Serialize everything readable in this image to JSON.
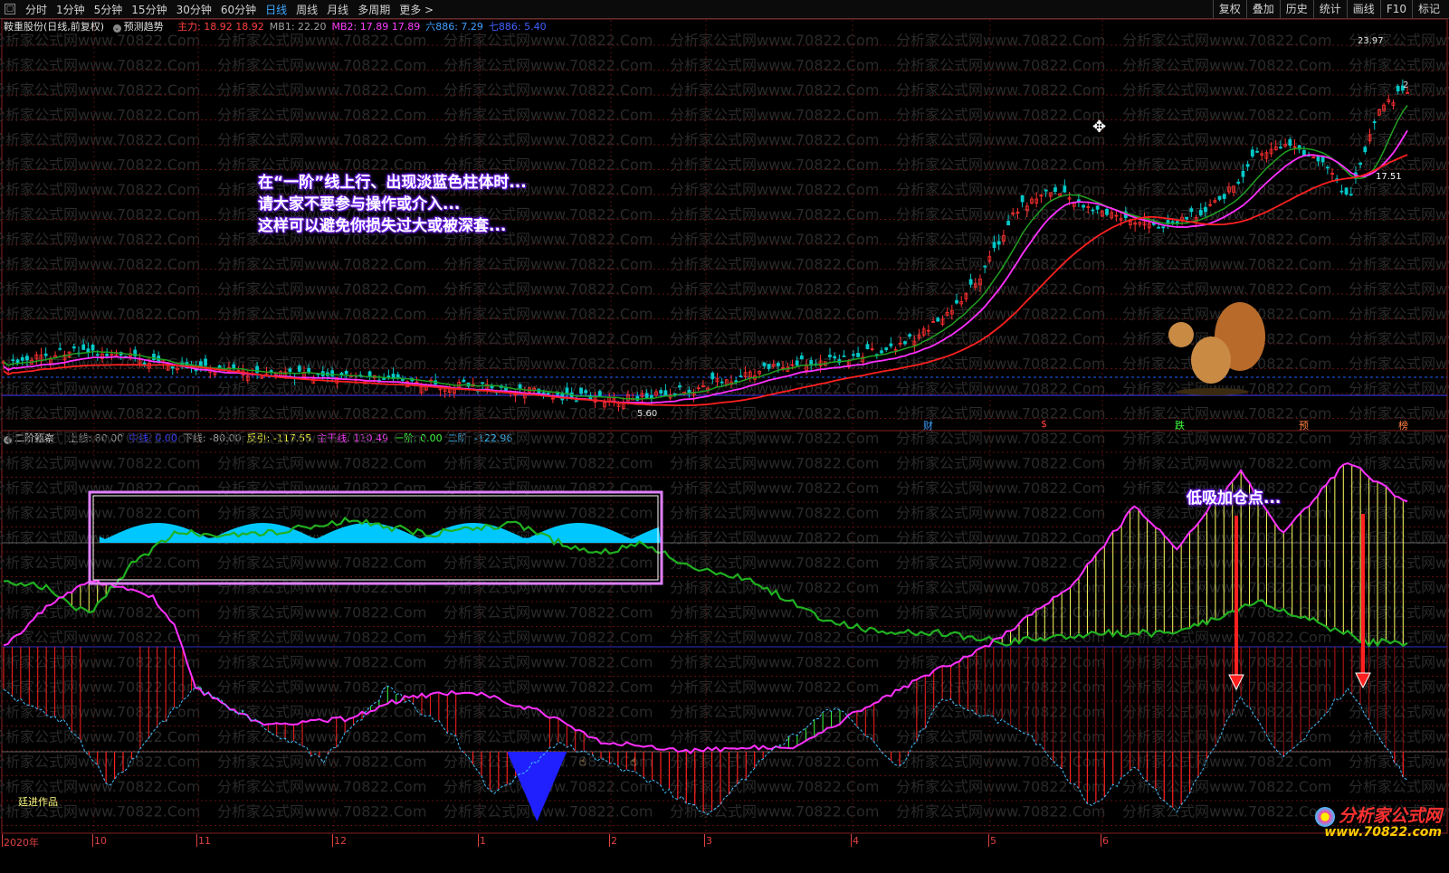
{
  "toolbar": {
    "menu_icon": "window-icon",
    "periods": [
      "分时",
      "1分钟",
      "5分钟",
      "15分钟",
      "30分钟",
      "60分钟",
      "日线",
      "周线",
      "月线",
      "多周期",
      "更多 >"
    ],
    "active_period": "日线",
    "tools": [
      "复权",
      "叠加",
      "历史",
      "统计",
      "画线",
      "F10",
      "标记"
    ]
  },
  "main_panel": {
    "stock_title": "鞍重股份(日线,前复权)",
    "forecast_label": "预测趋势",
    "indicators": [
      {
        "label": "主力:",
        "value": "18.92",
        "value2": "18.92",
        "color": "#ff4040"
      },
      {
        "label": "MB1:",
        "value": "22.20",
        "color": "#a0a0a0"
      },
      {
        "label": "MB2:",
        "value": "17.89",
        "value2": "17.89",
        "color": "#ff40ff"
      },
      {
        "label": "六886:",
        "value": "7.29",
        "color": "#40a0ff"
      },
      {
        "label": "七886:",
        "value": "5.40",
        "color": "#4060ff"
      }
    ],
    "price_high": "23.97",
    "price_mark_2": "2",
    "price_mid": "17.51",
    "price_low": "5.60",
    "event_tags": [
      {
        "text": "财",
        "color": "#40a0ff"
      },
      {
        "text": "$",
        "color": "#ff4040"
      },
      {
        "text": "跌",
        "color": "#40ff40"
      },
      {
        "text": "预",
        "color": "#ff8040"
      },
      {
        "text": "榜",
        "color": "#ff8040"
      }
    ],
    "annotation_lines": [
      "在“一阶”线上行、出现淡蓝色柱体时...",
      "请大家不要参与操作或介入...",
      "这样可以避免你损失过大或被深套..."
    ]
  },
  "sub_panel": {
    "indicator_name": "二阶甄察",
    "legend": [
      {
        "label": "上线:",
        "value": "80.00",
        "color": "#a0a0a0"
      },
      {
        "label": "中线:",
        "value": "0.00",
        "color": "#4040ff"
      },
      {
        "label": "下线:",
        "value": "-80.00",
        "color": "#a0a0a0"
      },
      {
        "label": "反引:",
        "value": "-117.55",
        "color": "#ffff40"
      },
      {
        "label": "主干线:",
        "value": "110.49",
        "color": "#ff40ff"
      },
      {
        "label": "一阶:",
        "value": "0.00",
        "color": "#40ff40"
      },
      {
        "label": "二阶:",
        "value": "-122.96",
        "color": "#40c0ff"
      }
    ],
    "annotation": "低吸加仓点...",
    "author_note": "廷进作品"
  },
  "date_axis": [
    "2020年",
    "10",
    "11",
    "12",
    "1",
    "2",
    "3",
    "4",
    "5",
    "6"
  ],
  "watermark": {
    "brand": "分析家公式网",
    "url": "www.70822.com"
  },
  "background_watermark": "分析家公式网www.70822.Com",
  "colors": {
    "up": "#ff3030",
    "down": "#00c8c8",
    "ma_red": "#ff2020",
    "ma_magenta": "#ff30ff",
    "ma_green": "#20a020",
    "yellow_bar": "#ffff60",
    "red_bar": "#ff2020",
    "green_bar": "#40ff40",
    "blue_fill": "#2020ff",
    "cyan_fill": "#00c8ff"
  }
}
